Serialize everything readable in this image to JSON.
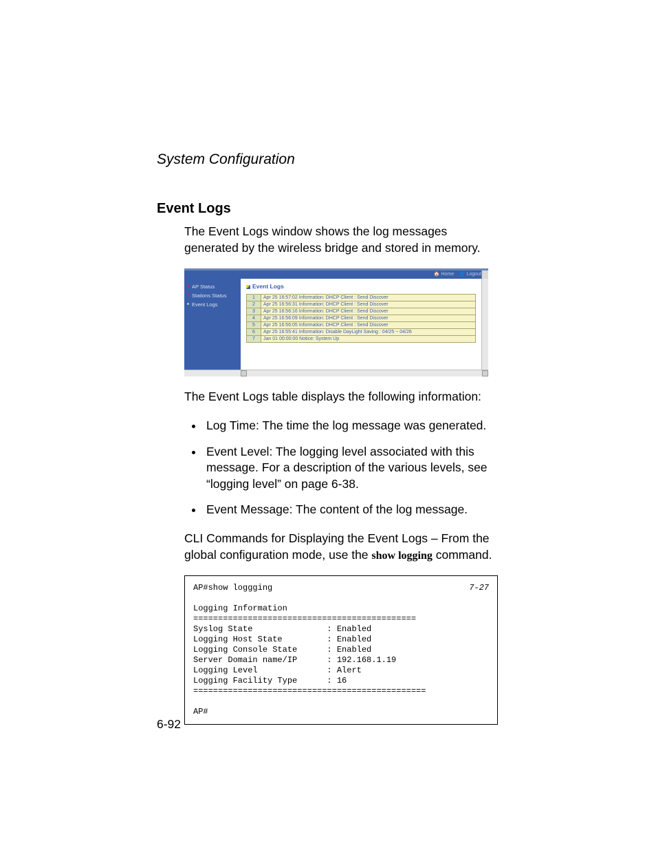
{
  "chapter_title": "System Configuration",
  "section_title": "Event Logs",
  "intro_text": "The Event Logs window shows the log messages generated by the wireless bridge and stored in memory.",
  "screenshot": {
    "topbar": {
      "home": "Home",
      "logout": "Logout"
    },
    "sidebar": [
      {
        "label": "AP Status",
        "active": false
      },
      {
        "label": "Stations Status",
        "active": false
      },
      {
        "label": "Event Logs",
        "active": true
      }
    ],
    "panel_title": "Event Logs",
    "rows": [
      {
        "n": "1",
        "msg": "Apr 25 16:57:02 Information: DHCP Client : Send Discover"
      },
      {
        "n": "2",
        "msg": "Apr 25 16:56:31 Information: DHCP Client : Send Discover"
      },
      {
        "n": "3",
        "msg": "Apr 25 16:56:16 Information: DHCP Client : Send Discover"
      },
      {
        "n": "4",
        "msg": "Apr 25 16:56:09 Information: DHCP Client : Send Discover"
      },
      {
        "n": "5",
        "msg": "Apr 25 16:56:05 Information: DHCP Client : Send Discover"
      },
      {
        "n": "6",
        "msg": "Apr 25 16:55:41 Information: Disable DayLight Saving : 04/25 ~ 04/26"
      },
      {
        "n": "7",
        "msg": "Jan 01 00:00:00 Notice: System Up"
      }
    ]
  },
  "after_shot_text": "The Event Logs table displays the following information:",
  "bullets": [
    "Log Time: The time the log message was generated.",
    "Event Level: The logging level associated with this message. For a description of the various levels, see “logging level” on page 6-38.",
    "Event Message: The content of the log message."
  ],
  "cli_intro_a": "CLI Commands for Displaying the Event Logs – From the global configuration mode, use the ",
  "cli_cmd": "show logging",
  "cli_intro_b": " command.",
  "cli_block": "AP#show loggging\n\nLogging Information\n=============================================\nSyslog State               : Enabled\nLogging Host State         : Enabled\nLogging Console State      : Enabled\nServer Domain name/IP      : 192.168.1.19\nLogging Level              : Alert\nLogging Facility Type      : 16\n===============================================\n\nAP#",
  "cli_ref": "7-27",
  "page_number": "6-92"
}
